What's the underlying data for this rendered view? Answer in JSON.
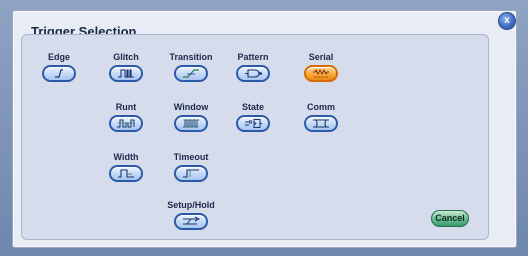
{
  "dialog": {
    "title": "Trigger Selection",
    "close_label": "x",
    "cancel_label": "Cancel"
  },
  "triggers": [
    {
      "label": "Edge",
      "icon": "edge-icon",
      "selected": false
    },
    {
      "label": "Glitch",
      "icon": "glitch-icon",
      "selected": false
    },
    {
      "label": "Transition",
      "icon": "transition-icon",
      "selected": false
    },
    {
      "label": "Pattern",
      "icon": "pattern-icon",
      "selected": false
    },
    {
      "label": "Serial",
      "icon": "serial-icon",
      "selected": true
    },
    {
      "label": "Runt",
      "icon": "runt-icon",
      "selected": false
    },
    {
      "label": "Window",
      "icon": "window-icon",
      "selected": false
    },
    {
      "label": "State",
      "icon": "state-icon",
      "selected": false
    },
    {
      "label": "Comm",
      "icon": "comm-icon",
      "selected": false
    },
    {
      "label": "Width",
      "icon": "width-icon",
      "selected": false
    },
    {
      "label": "Timeout",
      "icon": "timeout-icon",
      "selected": false
    },
    {
      "label": "Setup/Hold",
      "icon": "setup-hold-icon",
      "selected": false
    }
  ],
  "colors": {
    "accent": "#2b5aa8",
    "selected": "#f9a83a",
    "cancel": "#3d9a6b"
  }
}
